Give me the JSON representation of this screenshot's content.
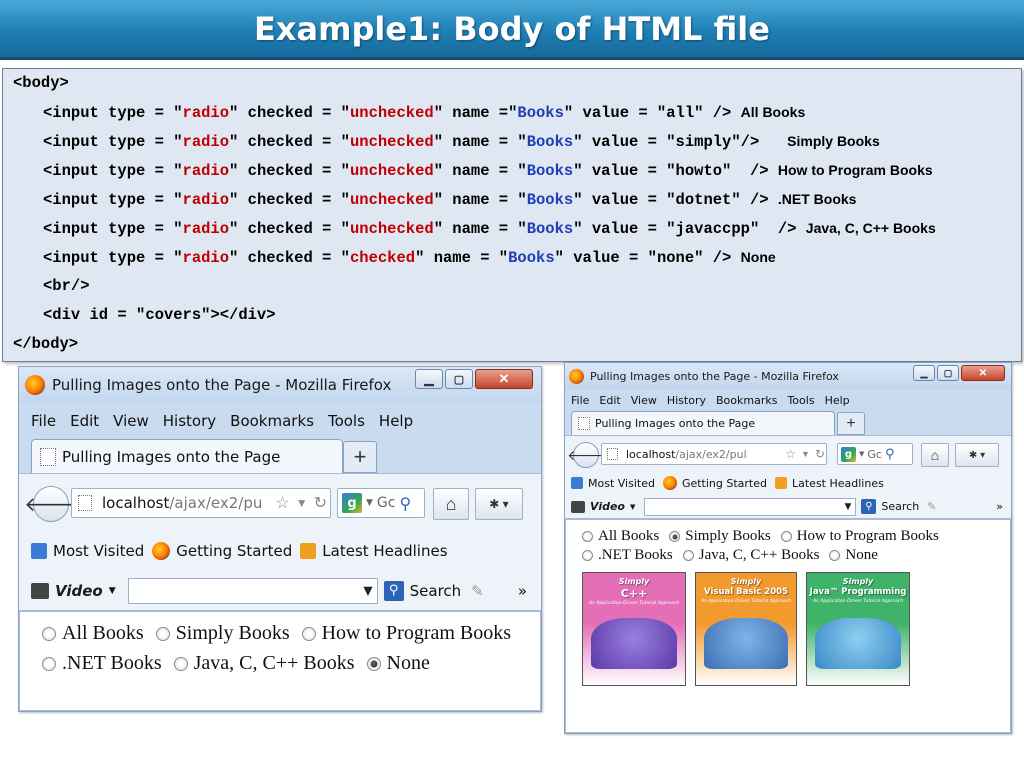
{
  "slide": {
    "title": "Example1: Body of HTML file"
  },
  "code": {
    "body_open": "<body>",
    "body_close": "</body>",
    "br": "<br/>",
    "div": "<div id = \"covers\"></div>",
    "input_prefix": "<input type = \"",
    "radio": "radio",
    "checked_attr": "\" checked = \"",
    "unchecked": "unchecked",
    "checked": "checked",
    "name_eq_nospace": "\" name =\"",
    "name_eq": "\" name = \"",
    "books": "Books",
    "lines": [
      {
        "value": "\" value = \"all\" />",
        "label": "All Books"
      },
      {
        "value": "\" value = \"simply\"/>",
        "label": "Simply Books"
      },
      {
        "value": "\" value = \"howto\"  />",
        "label": "How to Program Books"
      },
      {
        "value": "\" value = \"dotnet\" />",
        "label": ".NET Books"
      },
      {
        "value": "\" value = \"javaccpp\"  />",
        "label": "Java, C, C++ Books"
      },
      {
        "value": "\" value = \"none\" />",
        "label": "None"
      }
    ]
  },
  "firefox": {
    "window_title": "Pulling Images onto the Page - Mozilla Firefox",
    "menu": [
      "File",
      "Edit",
      "View",
      "History",
      "Bookmarks",
      "Tools",
      "Help"
    ],
    "tab_title": "Pulling Images onto the Page",
    "new_tab": "+",
    "url_host": "localhost",
    "url_path_left": "/ajax/ex2/pu",
    "url_path_right": "/ajax/ex2/pul",
    "search_placeholder_left": "Gc",
    "bookmarks": [
      "Most Visited",
      "Getting Started",
      "Latest Headlines"
    ],
    "video_label": "Video",
    "search_button": "Search",
    "overflow": "»",
    "radios": {
      "all": "All Books",
      "simply": "Simply Books",
      "howto": "How to Program Books",
      "dotnet": ".NET Books",
      "javaccpp": "Java, C, C++ Books",
      "none": "None"
    }
  },
  "covers": [
    {
      "series": "Simply",
      "title": "C++",
      "subtitle": "An Application-Driven Tutorial Approach",
      "color": "#e46fb7"
    },
    {
      "series": "Simply",
      "title": "Visual Basic 2005",
      "subtitle": "An Application-Driven Tutorial Approach",
      "color": "#f29a2e"
    },
    {
      "series": "Simply",
      "title": "Java™ Programming",
      "subtitle": "An Application-Driven Tutorial Approach",
      "color": "#3fb36a"
    }
  ],
  "colors": {
    "title_bar": "#1f7fb5",
    "code_bg": "#dfe7f3",
    "code_red": "#c00000",
    "code_blue": "#1f3fb5"
  }
}
